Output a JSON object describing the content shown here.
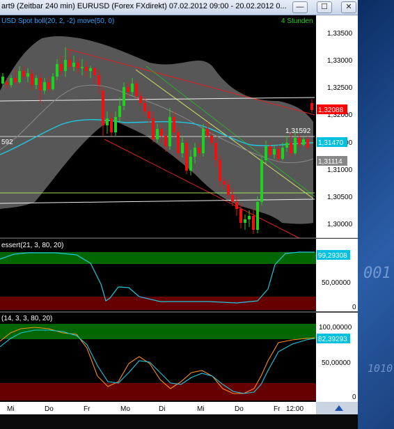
{
  "window": {
    "title": "art9 (Zeitbar 240 min)  EURUSD (Forex FXdirekt) 07.02.2012 09:00 - 20.02.2012 0...",
    "min_glyph": "—",
    "max_glyph": "☐",
    "close_glyph": "✕"
  },
  "main_panel": {
    "legend": "USD Spot boll(20, 2, -2) move(50, 0)",
    "timeframe": "4 Stunden",
    "left_marker": "592",
    "price_labels": [
      "1,33500",
      "1,33000",
      "1,32500",
      "1,32000",
      "1,31500",
      "1,31000",
      "1,30500",
      "1,30000"
    ],
    "tag_current": "1,32088",
    "tag_ma": "1,31470",
    "tag_bb": "1,31114",
    "annotation": "1,31592"
  },
  "panel2": {
    "legend": "essert(21, 3, 80, 20)",
    "value_tag": "99,29308",
    "labels": [
      "50,00000",
      "0"
    ]
  },
  "panel3": {
    "legend": "(14, 3, 3, 80, 20)",
    "labels": [
      "100,00000",
      "50,00000",
      "0"
    ],
    "value_tag": "82,39293"
  },
  "x_axis": {
    "labels": [
      "Mi",
      "Do",
      "Fr",
      "Mo",
      "Di",
      "Mi",
      "Do",
      "Fr",
      "12:00"
    ]
  },
  "desktop": {
    "text1": "001",
    "text2": "1010"
  },
  "colors": {
    "bull": "#22d022",
    "bear": "#ee1111",
    "band": "#5a5a5a",
    "ma": "#1ec8e0",
    "zone_green": "#006600",
    "zone_red": "#660000",
    "tag_red": "#ff0000",
    "tag_cyan": "#00c0e0"
  }
}
